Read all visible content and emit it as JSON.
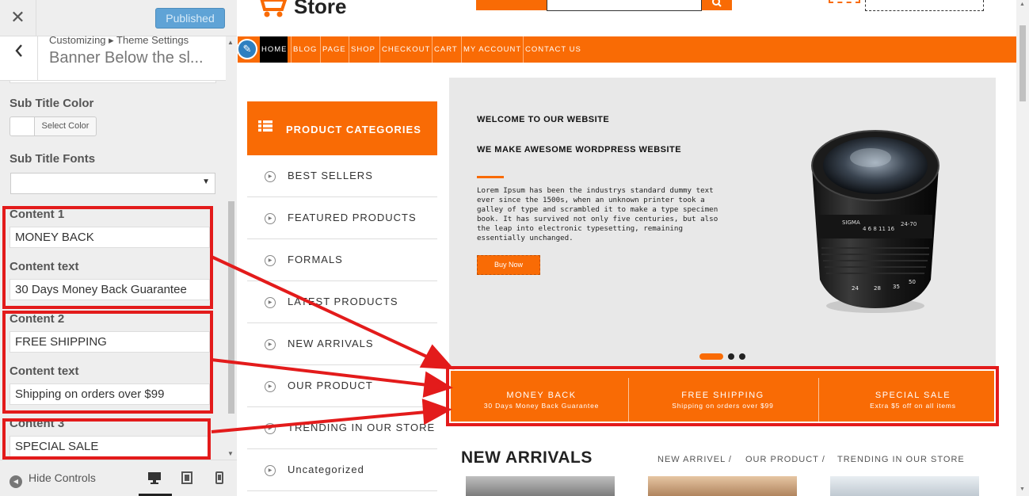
{
  "sidebar": {
    "close_label": "✕",
    "publish_label": "Published",
    "back_label": "‹",
    "breadcrumb": "Customizing ▸ Theme Settings",
    "section_title": "Banner Below the sl...",
    "subtitle_color_label": "Sub Title Color",
    "select_color_label": "Select Color",
    "subtitle_fonts_label": "Sub Title Fonts",
    "subtitle_fonts_value": "",
    "content1_label": "Content 1",
    "content1_value": "MONEY BACK",
    "content1_text_label": "Content text",
    "content1_text_value": "30 Days Money Back Guarantee",
    "content2_label": "Content 2",
    "content2_value": "FREE SHIPPING",
    "content2_text_label": "Content text",
    "content2_text_value": "Shipping on orders over $99",
    "content3_label": "Content 3",
    "content3_value": "SPECIAL SALE",
    "hide_controls_label": "Hide Controls",
    "devices": [
      "desktop-icon",
      "tablet-icon",
      "mobile-icon"
    ]
  },
  "preview": {
    "logo_text": "Store",
    "nav": [
      "HOME",
      "BLOG",
      "PAGE",
      "SHOP",
      "CHECKOUT",
      "CART",
      "MY ACCOUNT",
      "CONTACT US"
    ],
    "categories_title": "PRODUCT CATEGORIES",
    "categories": [
      "BEST SELLERS",
      "FEATURED PRODUCTS",
      "FORMALS",
      "LATEST PRODUCTS",
      "NEW ARRIVALS",
      "OUR PRODUCT",
      "TRENDING IN OUR STORE",
      "Uncategorized"
    ],
    "banner": {
      "kicker": "WELCOME TO OUR WEBSITE",
      "title": "WE MAKE AWESOME WORDPRESS WEBSITE",
      "body": "Lorem Ipsum has been the industrys standard dummy text ever since the 1500s, when an unknown printer took a galley of type and scrambled it to make a type specimen book. It has survived not only five centuries, but also the leap into electronic typesetting, remaining essentially unchanged.",
      "button": "Buy Now",
      "slides": 3,
      "active_slide": 1
    },
    "services": [
      {
        "title": "MONEY BACK",
        "sub": "30 Days Money Back Guarantee"
      },
      {
        "title": "FREE SHIPPING",
        "sub": "Shipping on orders over $99"
      },
      {
        "title": "SPECIAL SALE",
        "sub": "Extra $5 off on all items"
      }
    ],
    "new_arrivals_title": "NEW ARRIVALS",
    "tabs": [
      "NEW ARRIVEL /",
      "OUR PRODUCT /",
      "TRENDING IN OUR STORE"
    ]
  },
  "colors": {
    "accent": "#f96b05",
    "annotation": "#e31b1b",
    "publish": "#5fa3d6"
  }
}
